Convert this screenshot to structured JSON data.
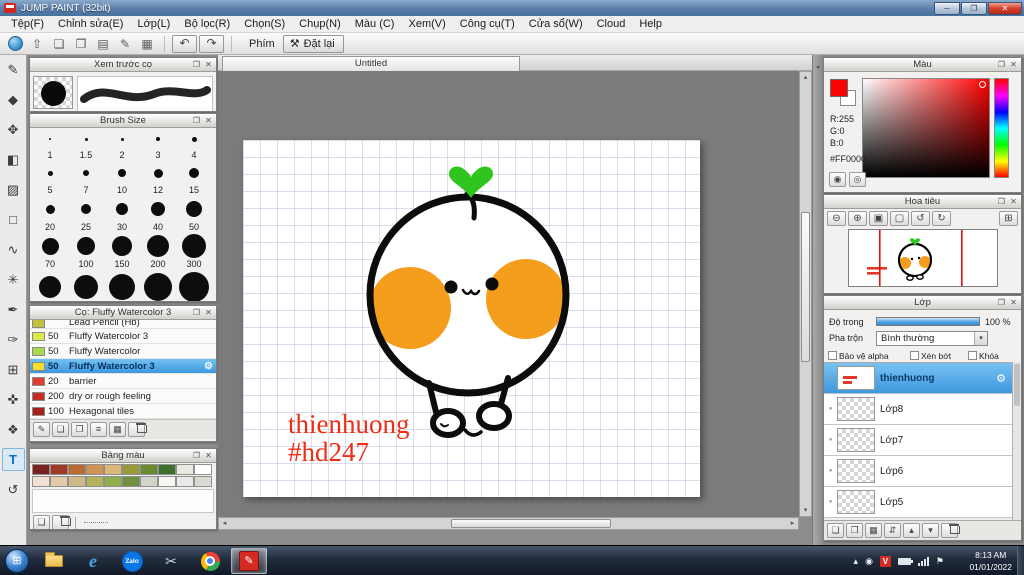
{
  "window": {
    "title": "JUMP PAINT (32bit)"
  },
  "menu": {
    "items": [
      "Tệp(F)",
      "Chỉnh sửa(E)",
      "Lớp(L)",
      "Bộ lọc(R)",
      "Chọn(S)",
      "Chụp(N)",
      "Màu (C)",
      "Xem(V)",
      "Công cụ(T)",
      "Cửa sổ(W)",
      "Cloud",
      "Help"
    ]
  },
  "toolbar": {
    "phim": "Phím",
    "reset": "Đặt lại"
  },
  "left_panels": {
    "brush_preview": {
      "title": "Xem trước cọ"
    },
    "brush_size": {
      "title": "Brush Size",
      "sizes": [
        "1",
        "1.5",
        "2",
        "3",
        "4",
        "5",
        "7",
        "10",
        "12",
        "15",
        "20",
        "25",
        "30",
        "40",
        "50",
        "70",
        "100",
        "150",
        "200",
        "300"
      ]
    },
    "brush_list": {
      "title": "Cọ: Fluffy Watercolor 3",
      "items": [
        {
          "size": "",
          "name": "Lead Pencil (Hb)",
          "color": "#c2c23a"
        },
        {
          "size": "50",
          "name": "Fluffy Watercolor 3",
          "color": "#dce84e"
        },
        {
          "size": "50",
          "name": "Fluffy Watercolor",
          "color": "#a9d84b"
        },
        {
          "size": "50",
          "name": "Fluffy Watercolor 3",
          "color": "#f2df2e"
        },
        {
          "size": "20",
          "name": "barrier",
          "color": "#e23c30"
        },
        {
          "size": "200",
          "name": "dry or rough feeling",
          "color": "#c22d24"
        },
        {
          "size": "100",
          "name": "Hexagonal tiles",
          "color": "#a92019"
        }
      ]
    },
    "palette": {
      "title": "Bảng màu",
      "row1": [
        "#7a2020",
        "#a03a24",
        "#b96a33",
        "#cf9352",
        "#dcb878",
        "#9a9a38",
        "#6a8a34",
        "#3f6f2c",
        "#e9e9df",
        "#ffffff"
      ],
      "row2": [
        "#f1e3d3",
        "#e3cba9",
        "#cdb98a",
        "#b3b35c",
        "#8fae4e",
        "#6f9040",
        "#d3d3c9",
        "#f7f7ef",
        "#e9e9e9",
        "#dadad2"
      ]
    }
  },
  "canvas": {
    "tab": "Untitled",
    "text1": "thienhuong",
    "text2": "#hd247",
    "text_color": "#ee2d16",
    "cheek_color": "#f59e1d",
    "sprout_color": "#2fc51e"
  },
  "right_panels": {
    "color": {
      "title": "Màu",
      "r": "R:255",
      "g": "G:0",
      "b": "B:0",
      "hex": "#FF0000",
      "current": "#ff0000"
    },
    "navigator": {
      "title": "Hoa tiêu"
    },
    "layers": {
      "title": "Lớp",
      "opacity_label": "Độ trong",
      "opacity_value": "100 %",
      "blend_label": "Pha trộn",
      "blend_value": "Bình thường",
      "cb_alpha": "Bảo vệ alpha",
      "cb_clip": "Xén bớt",
      "cb_lock": "Khóa",
      "items": [
        {
          "name": "thienhuong"
        },
        {
          "name": "Lớp8"
        },
        {
          "name": "Lớp7"
        },
        {
          "name": "Lớp6"
        },
        {
          "name": "Lớp5"
        }
      ]
    }
  },
  "taskbar": {
    "zalo": "Zalo",
    "ime": "V",
    "time": "8:13 AM",
    "date": "01/01/2022"
  }
}
